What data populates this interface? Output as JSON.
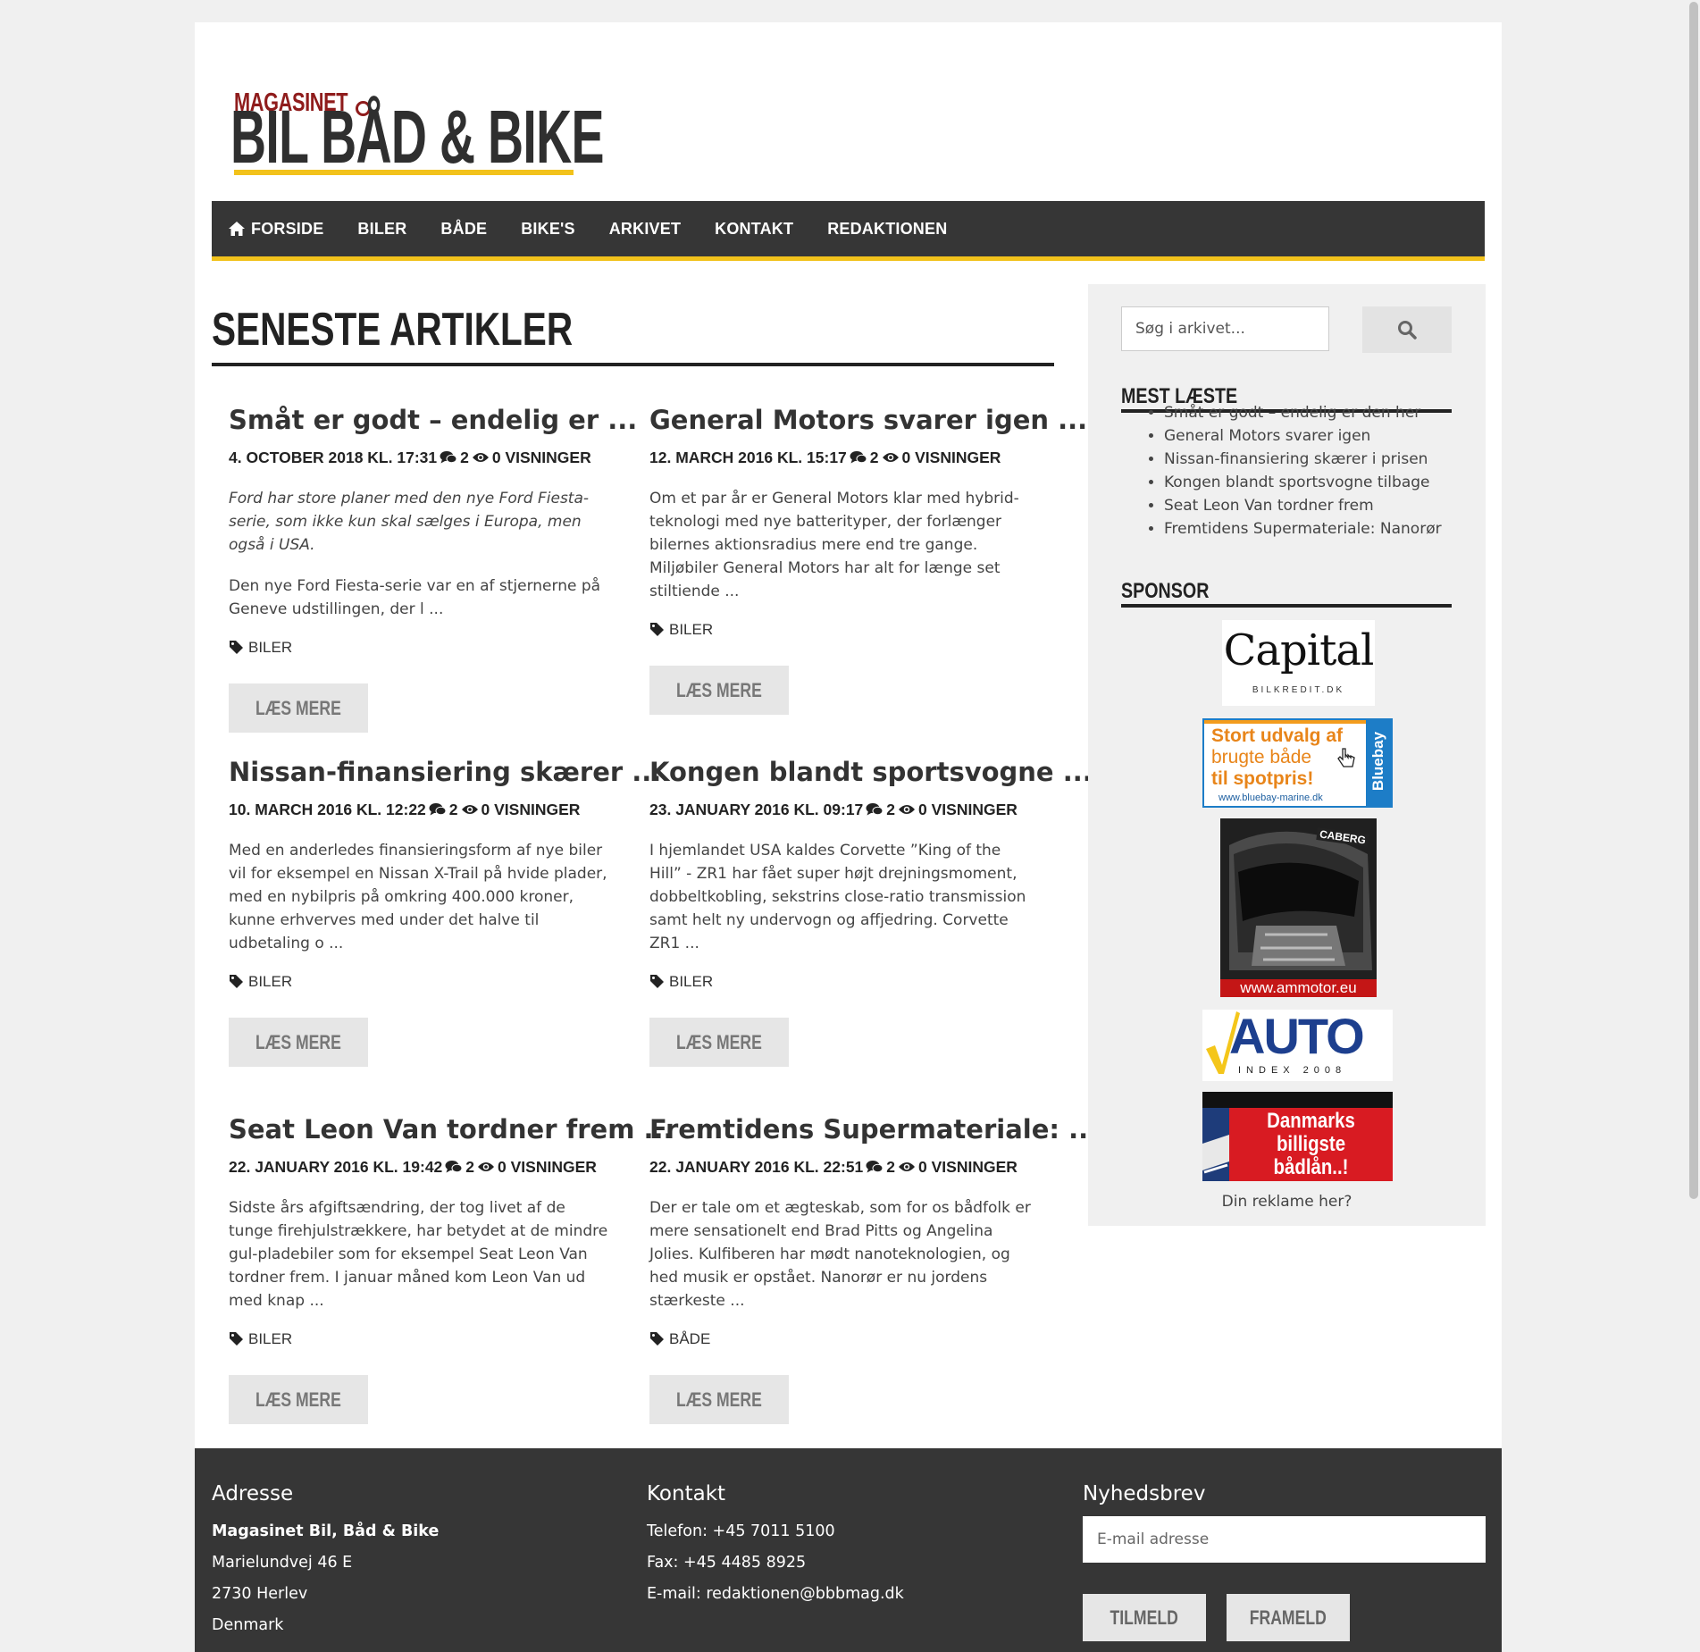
{
  "logo": {
    "line1": "MAGASINET",
    "line2": "BIL BÅD & BIKE"
  },
  "nav": {
    "items": [
      "FORSIDE",
      "BILER",
      "BÅDE",
      "BIKE'S",
      "ARKIVET",
      "KONTAKT",
      "REDAKTIONEN"
    ]
  },
  "main": {
    "section_title": "SENESTE ARTIKLER",
    "articles": [
      {
        "title": "Småt er godt – endelig er ...",
        "date": "4. OCTOBER 2018 KL. 17:31",
        "comments": "2",
        "views": "0 VISNINGER",
        "excerpt_italic": "Ford har store planer med den nye Ford Fiesta- serie, som ikke kun skal sælges i Europa, men også i USA.",
        "excerpt": "Den nye Ford Fiesta-serie var en af stjernerne på Geneve udstillingen, der l ...",
        "tag": "BILER",
        "button": "LÆS MERE"
      },
      {
        "title": "General Motors svarer igen ...",
        "date": "12. MARCH 2016 KL. 15:17",
        "comments": "2",
        "views": "0 VISNINGER",
        "excerpt": "Om et par år er General Motors klar med hybrid-teknologi med nye batterityper, der forlænger bilernes aktionsradius mere end tre gange. Miljøbiler General Motors har alt for længe set stiltiende ...",
        "tag": "BILER",
        "button": "LÆS MERE"
      },
      {
        "title": "Nissan-finansiering skærer ...",
        "date": "10. MARCH 2016 KL. 12:22",
        "comments": "2",
        "views": "0 VISNINGER",
        "excerpt": "Med en anderledes finansieringsform af nye biler vil for eksempel en Nissan X-Trail på hvide plader, med en nybilpris på omkring 400.000 kroner, kunne erhverves med under det halve til udbetaling o ...",
        "tag": "BILER",
        "button": "LÆS MERE"
      },
      {
        "title": "Kongen blandt sportsvogne ...",
        "date": "23. JANUARY 2016 KL. 09:17",
        "comments": "2",
        "views": "0 VISNINGER",
        "excerpt": "I hjemlandet USA kaldes Corvette ”King of the Hill” - ZR1 har fået super højt drejningsmoment, dobbeltkobling, sekstrins close-ratio transmission samt helt ny undervogn og affjedring. Corvette ZR1 ...",
        "tag": "BILER",
        "button": "LÆS MERE"
      },
      {
        "title": "Seat Leon Van tordner frem ...",
        "date": "22. JANUARY 2016 KL. 19:42",
        "comments": "2",
        "views": "0 VISNINGER",
        "excerpt": "Sidste års afgiftsændring, der tog livet af de tunge firehjulstrækkere, har betydet at de mindre gul-pladebiler som for eksempel Seat Leon Van tordner frem. I januar måned kom Leon Van ud med knap ...",
        "tag": "BILER",
        "button": "LÆS MERE"
      },
      {
        "title": "Fremtidens Supermateriale: ...",
        "date": "22. JANUARY 2016 KL. 22:51",
        "comments": "2",
        "views": "0 VISNINGER",
        "excerpt": "Der er tale om et ægteskab, som for os bådfolk er mere sensationelt end Brad Pitts og Angelina Jolies. Kulfiberen har mødt nanoteknologien, og hed musik er opstået. Nanorør er nu jordens stærkeste ...",
        "tag": "BÅDE",
        "button": "LÆS MERE"
      }
    ]
  },
  "sidebar": {
    "search_placeholder": "Søg i arkivet...",
    "most_read_title": "MEST LÆSTE",
    "most_read": [
      "Småt er godt – endelig er den her",
      "General Motors svarer igen",
      "Nissan-finansiering skærer i prisen",
      "Kongen blandt sportsvogne tilbage",
      "Seat Leon Van tordner frem",
      "Fremtidens Supermateriale: Nanorør"
    ],
    "sponsor_title": "SPONSOR",
    "sponsors": {
      "capital": {
        "name": "Capital",
        "sub": "BILKREDIT.DK"
      },
      "bluebay": {
        "line1": "Stort udvalg af",
        "line2": "brugte både",
        "line3": "til spotpris!",
        "url": "www.bluebay-marine.dk",
        "brand": "Bluebay"
      },
      "ammotor": {
        "brand": "CABERG",
        "url": "www.ammotor.eu"
      },
      "autoindex": {
        "name": "AUTO",
        "sub": "INDEX 2008"
      },
      "baadlaan": {
        "line1": "Danmarks",
        "line2": "billigste",
        "line3": "bådlån..!"
      }
    },
    "ad_text": "Din reklame her?"
  },
  "footer": {
    "address_title": "Adresse",
    "address": [
      "Magasinet Bil, Båd & Bike",
      "Marielundvej 46 E",
      "2730 Herlev",
      "Denmark"
    ],
    "contact_title": "Kontakt",
    "contact": [
      "Telefon: +45 7011 5100",
      "Fax: +45 4485 8925",
      "E-mail: redaktionen@bbbmag.dk"
    ],
    "newsletter_title": "Nyhedsbrev",
    "email_placeholder": "E-mail adresse",
    "subscribe": "TILMELD",
    "unsubscribe": "FRAMELD"
  },
  "colors": {
    "accent": "#f2c21b",
    "nav_bg": "#363636",
    "logo_red": "#8f1c1c"
  }
}
